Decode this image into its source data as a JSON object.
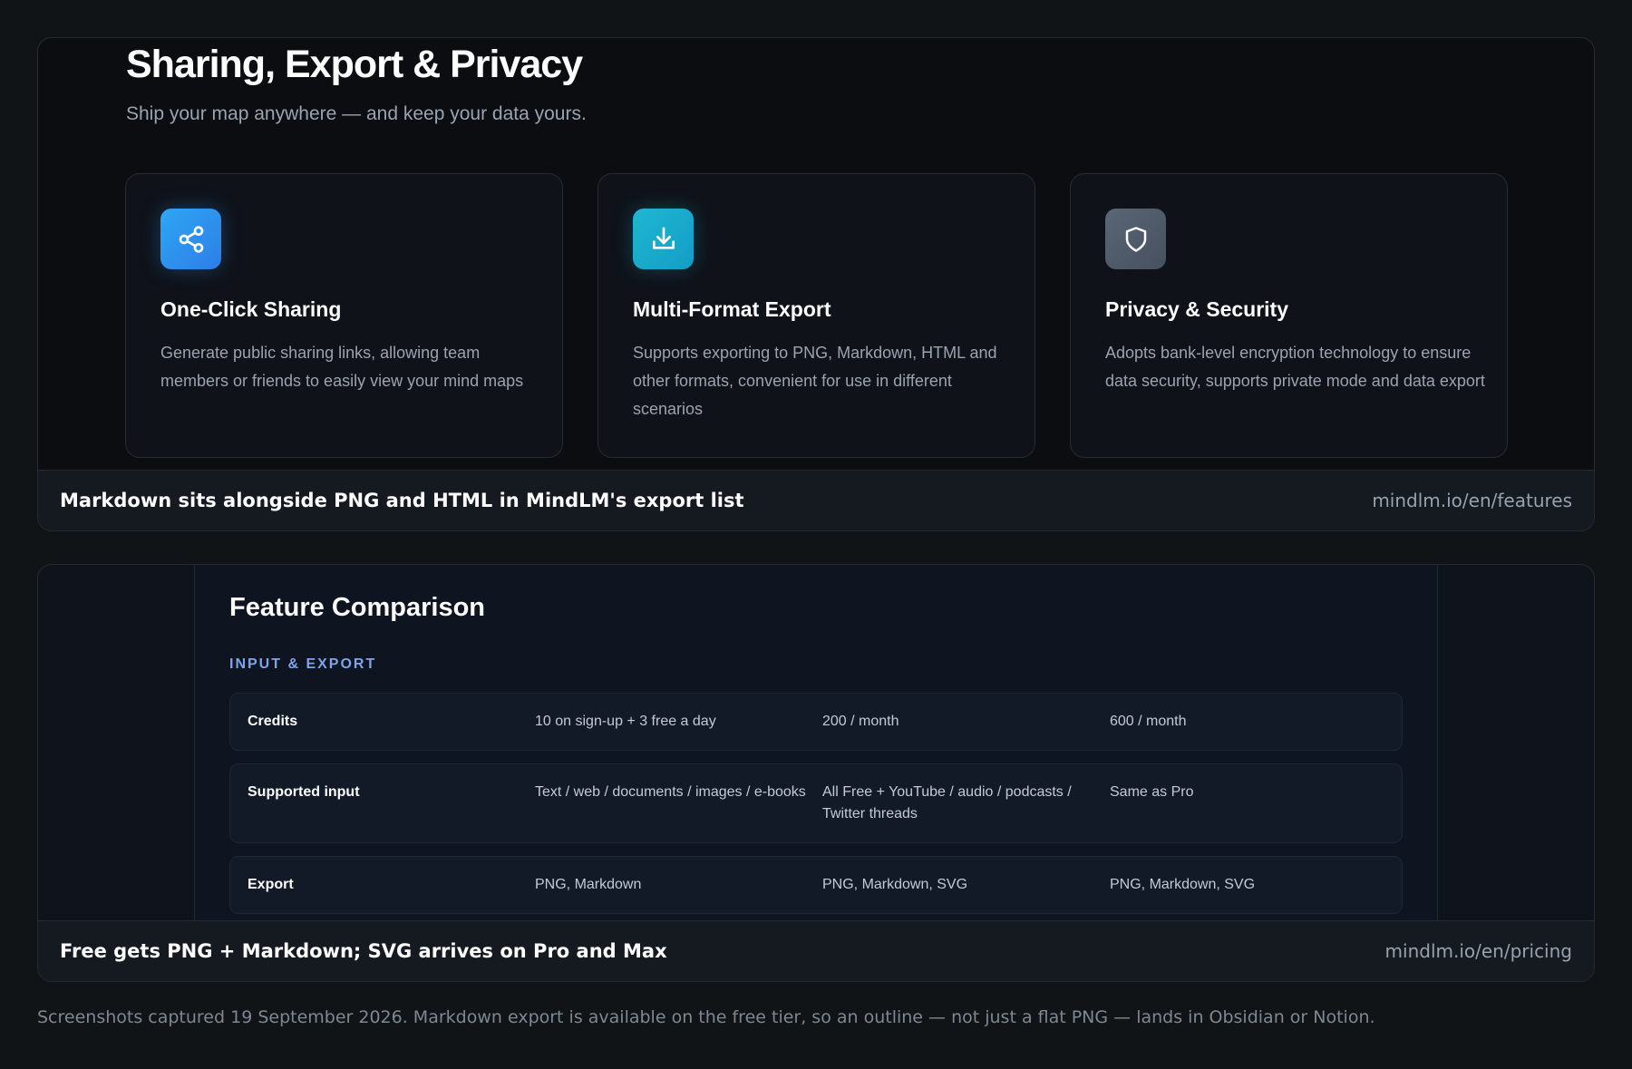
{
  "section1": {
    "title": "Sharing, Export & Privacy",
    "subtitle": "Ship your map anywhere — and keep your data yours.",
    "cards": [
      {
        "icon": "share-icon",
        "title": "One-Click Sharing",
        "description": "Generate public sharing links, allowing team members or friends to easily view your mind maps",
        "color": "#2d8cf0"
      },
      {
        "icon": "download-icon",
        "title": "Multi-Format Export",
        "description": "Supports exporting to PNG, Markdown, HTML and other formats, convenient for use in different scenarios",
        "color": "#1aa9cc"
      },
      {
        "icon": "shield-icon",
        "title": "Privacy & Security",
        "description": "Adopts bank-level encryption technology to ensure data security, supports private mode and data export",
        "color": "#525d6b"
      }
    ],
    "caption": "Markdown sits alongside PNG and HTML in MindLM's export list",
    "url": "mindlm.io/en/features"
  },
  "section2": {
    "title": "Feature Comparison",
    "section_label": "INPUT & EXPORT",
    "rows": [
      {
        "label": "Credits",
        "free": "10 on sign-up + 3 free a day",
        "pro": "200 / month",
        "max": "600 / month"
      },
      {
        "label": "Supported input",
        "free": "Text / web / documents / images / e-books",
        "pro": "All Free + YouTube / audio / podcasts / Twitter threads",
        "max": "Same as Pro"
      },
      {
        "label": "Export",
        "free": "PNG, Markdown",
        "pro": "PNG, Markdown, SVG",
        "max": "PNG, Markdown, SVG"
      }
    ],
    "caption": "Free gets PNG + Markdown; SVG arrives on Pro and Max",
    "url": "mindlm.io/en/pricing"
  },
  "footnote": "Screenshots captured 19 September 2026. Markdown export is available on the free tier, so an outline — not just a flat PNG — lands in Obsidian or Notion."
}
